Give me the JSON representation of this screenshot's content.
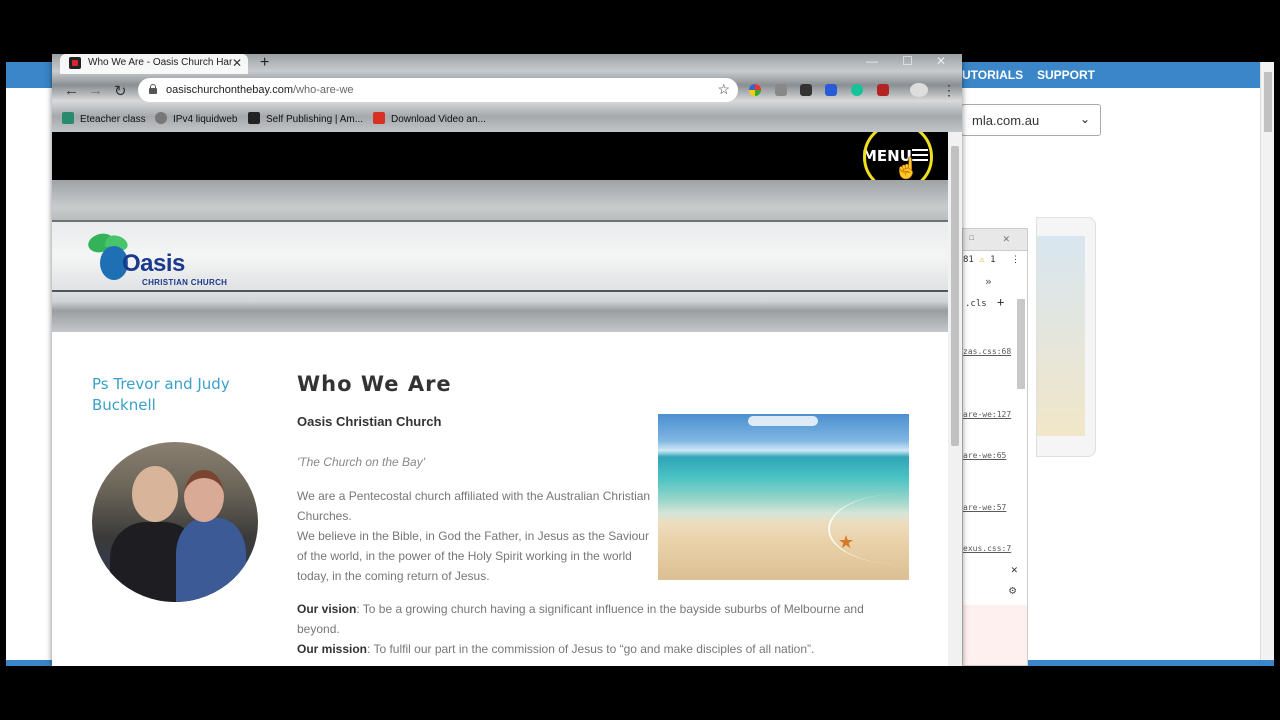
{
  "background_app": {
    "nav_tutorials": "UTORIALS",
    "nav_support": "SUPPORT",
    "domain_select": "mla.com.au",
    "devtools": {
      "counts": "81",
      "warnings": "1",
      "tab_overflow": "»",
      "cls": ".cls",
      "links": [
        "zas.css:68",
        "are-we:127",
        "are-we:65",
        "are-we:57",
        "exus.css:7"
      ]
    }
  },
  "browser": {
    "tab_title": "Who We Are - Oasis Church Har",
    "url_domain": "oasischurchonthebay.com",
    "url_path": "/who-are-we",
    "bookmarks": [
      {
        "label": "Eteacher class",
        "color": "#2a8a6e"
      },
      {
        "label": "IPv4 liquidweb",
        "color": "#777777"
      },
      {
        "label": "Self Publishing | Am...",
        "color": "#222222"
      },
      {
        "label": "Download Video an...",
        "color": "#d93025"
      }
    ]
  },
  "site": {
    "menu_label": "MENU",
    "logo": {
      "word": "Oasis",
      "sub": "CHRISTIAN CHURCH"
    },
    "sidebar": {
      "pastor_name": "Ps Trevor and Judy Bucknell"
    },
    "main": {
      "title": "Who We Are",
      "org_name": "Oasis Christian Church",
      "tagline": "'The Church on the Bay'",
      "para1": "We are a Pentecostal church affiliated with the Australian Christian Churches.",
      "para2": "We believe in the Bible, in God the Father, in Jesus as the Saviour of the world, in the power of the Holy Spirit working in the world today, in the coming return of Jesus.",
      "vision_label": "Our vision",
      "vision_text": ": To be a growing church having a significant influence in the bayside suburbs of Melbourne and beyond.",
      "mission_label": "Our mission",
      "mission_text": ": To fulfil our part in the commission of Jesus to “go and make disciples of all nation”."
    }
  },
  "colors": {
    "accent": "#3aa0c8",
    "bg_app_bar": "#3a86c8",
    "highlight": "#f0e020"
  }
}
